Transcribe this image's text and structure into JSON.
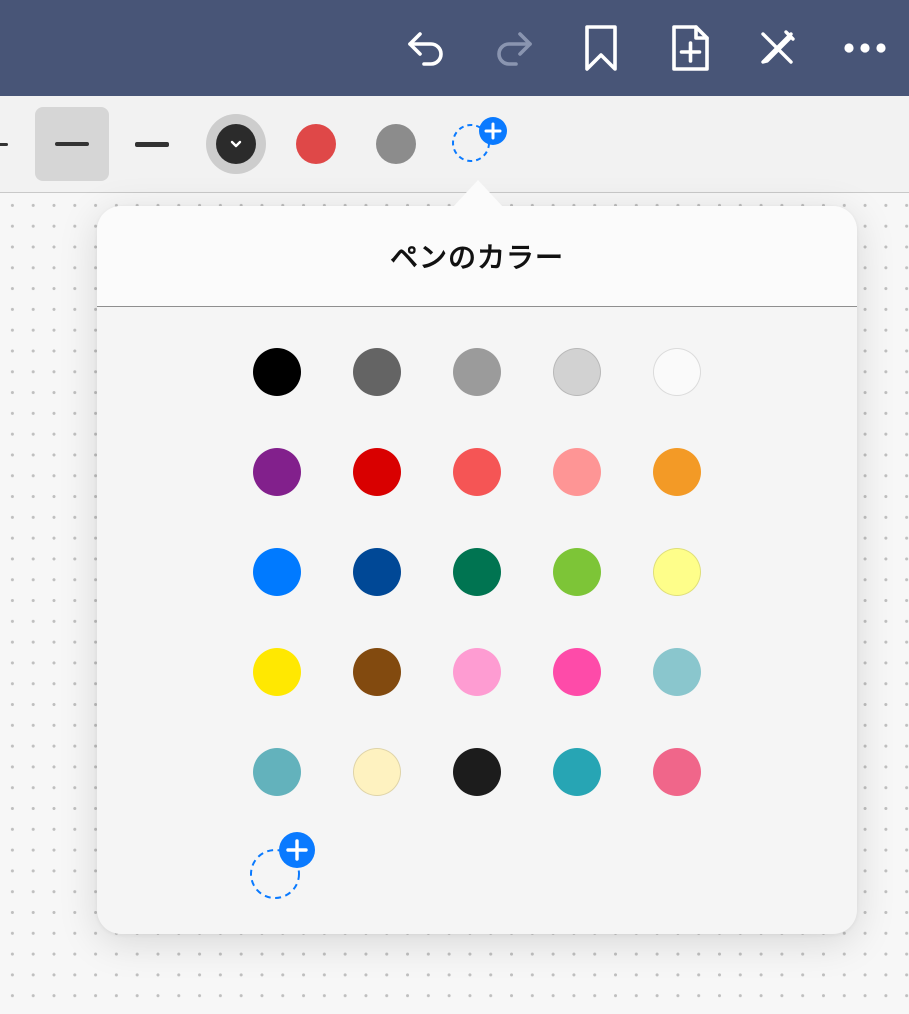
{
  "navbar": {
    "background": "#485577",
    "buttons": [
      {
        "name": "undo-button",
        "icon": "undo-icon"
      },
      {
        "name": "redo-button",
        "icon": "redo-icon"
      },
      {
        "name": "bookmark-button",
        "icon": "bookmark-icon"
      },
      {
        "name": "add-page-button",
        "icon": "add-page-icon"
      },
      {
        "name": "close-tools-button",
        "icon": "pencil-cross-icon"
      },
      {
        "name": "more-button",
        "icon": "more-horizontal-icon"
      }
    ]
  },
  "toolbar": {
    "stroke_widths": [
      "thin",
      "medium",
      "thick"
    ],
    "selected_stroke": "medium",
    "tool_colors": [
      "#2b2b2b",
      "#df4848",
      "#8c8c8c"
    ],
    "selected_color": "#2b2b2b",
    "accent": "#0a7aff"
  },
  "popover": {
    "title": "ペンのカラー",
    "colors": [
      "#000000",
      "#646464",
      "#9b9b9b",
      "#d2d2d2",
      "#fafafa",
      "#82208c",
      "#d90000",
      "#f55555",
      "#fe9595",
      "#f39a26",
      "#007aff",
      "#004896",
      "#007451",
      "#7dc537",
      "#fefe8a",
      "#ffe801",
      "#824a0f",
      "#fe9cd2",
      "#fe4ba9",
      "#8ac6cd",
      "#63b2bc",
      "#fef2c0",
      "#1c1c1c",
      "#27a5b4",
      "#f0668a"
    ],
    "add_color_icon": "add-color-icon"
  }
}
